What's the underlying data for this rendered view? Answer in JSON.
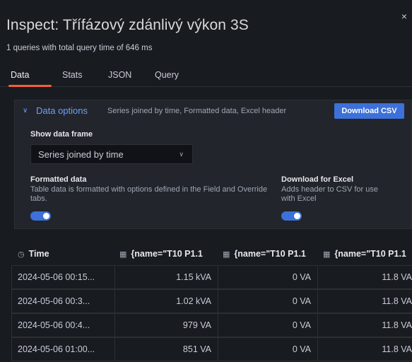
{
  "drawer": {
    "title": "Inspect: Třífázový zdánlivý výkon 3S",
    "subtitle": "1 queries with total query time of 646 ms",
    "close_icon": "×"
  },
  "tabs": [
    {
      "label": "Data",
      "active": true
    },
    {
      "label": "Stats",
      "active": false
    },
    {
      "label": "JSON",
      "active": false
    },
    {
      "label": "Query",
      "active": false
    }
  ],
  "options": {
    "title": "Data options",
    "summary": "Series joined by time, Formatted data, Excel header",
    "download_label": "Download CSV",
    "show_frame_label": "Show data frame",
    "show_frame_value": "Series joined by time",
    "formatted": {
      "label": "Formatted data",
      "desc": "Table data is formatted with options defined in the Field and Override tabs.",
      "enabled": true
    },
    "excel": {
      "label": "Download for Excel",
      "desc": "Adds header to CSV for use with Excel",
      "enabled": true
    }
  },
  "table": {
    "columns": [
      "Time",
      "{name=\"T10 P1.1",
      "{name=\"T10 P1.1",
      "{name=\"T10 P1.1"
    ],
    "rows": [
      [
        "2024-05-06 00:15...",
        "1.15 kVA",
        "0 VA",
        "11.8 VA"
      ],
      [
        "2024-05-06 00:3...",
        "1.02 kVA",
        "0 VA",
        "11.8 VA"
      ],
      [
        "2024-05-06 00:4...",
        "979 VA",
        "0 VA",
        "11.8 VA"
      ],
      [
        "2024-05-06 01:00...",
        "851 VA",
        "0 VA",
        "11.8 VA"
      ]
    ]
  },
  "colors": {
    "background": "#181b1f",
    "accent_blue": "#3d71d9",
    "tab_underline": "#f55f3e",
    "link_blue": "#6e9fff"
  }
}
